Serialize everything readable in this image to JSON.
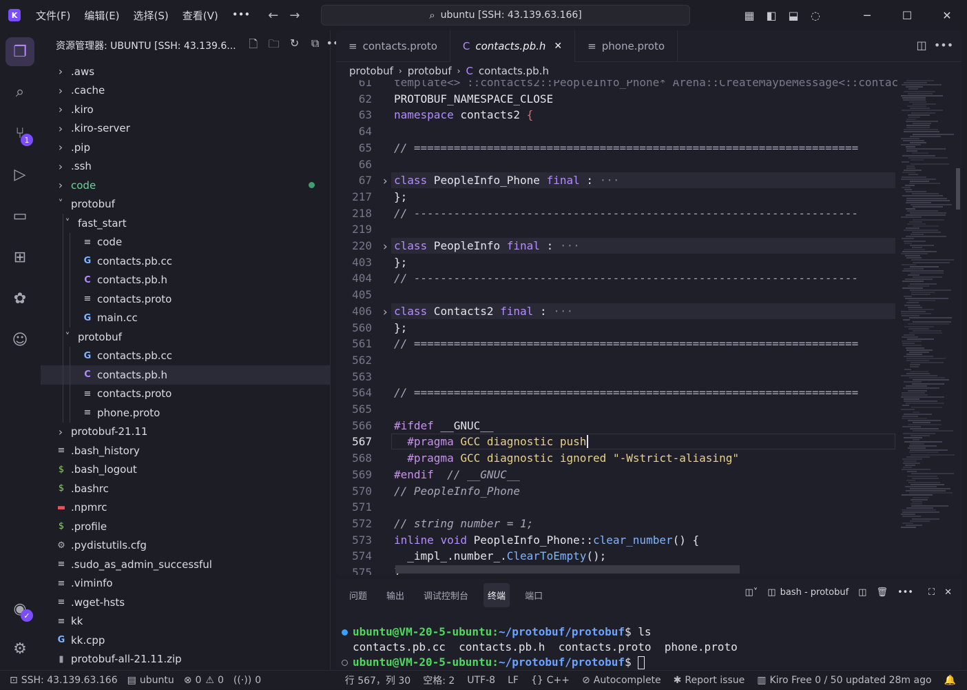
{
  "titlebar": {
    "logo": "K",
    "menus": [
      "文件(F)",
      "编辑(E)",
      "选择(S)",
      "查看(V)",
      "•••"
    ],
    "search": "ubuntu [SSH: 43.139.63.166]"
  },
  "activity": {
    "scm_badge": "1"
  },
  "sidebar": {
    "title": "资源管理器: UBUNTU [SSH: 43.139.6...",
    "tree": [
      {
        "label": ".aws",
        "level": 0,
        "type": "folder",
        "open": false
      },
      {
        "label": ".cache",
        "level": 0,
        "type": "folder",
        "open": false
      },
      {
        "label": ".kiro",
        "level": 0,
        "type": "folder",
        "open": false
      },
      {
        "label": ".kiro-server",
        "level": 0,
        "type": "folder",
        "open": false
      },
      {
        "label": ".pip",
        "level": 0,
        "type": "folder",
        "open": false
      },
      {
        "label": ".ssh",
        "level": 0,
        "type": "folder",
        "open": false
      },
      {
        "label": "code",
        "level": 0,
        "type": "folder",
        "open": false,
        "modified": true
      },
      {
        "label": "protobuf",
        "level": 0,
        "type": "folder",
        "open": true
      },
      {
        "label": "fast_start",
        "level": 1,
        "type": "folder",
        "open": true
      },
      {
        "label": "code",
        "level": 2,
        "type": "text"
      },
      {
        "label": "contacts.pb.cc",
        "level": 2,
        "type": "cpp"
      },
      {
        "label": "contacts.pb.h",
        "level": 2,
        "type": "c"
      },
      {
        "label": "contacts.proto",
        "level": 2,
        "type": "text"
      },
      {
        "label": "main.cc",
        "level": 2,
        "type": "cpp"
      },
      {
        "label": "protobuf",
        "level": 1,
        "type": "folder",
        "open": true
      },
      {
        "label": "contacts.pb.cc",
        "level": 2,
        "type": "cpp"
      },
      {
        "label": "contacts.pb.h",
        "level": 2,
        "type": "c",
        "selected": true
      },
      {
        "label": "contacts.proto",
        "level": 2,
        "type": "text"
      },
      {
        "label": "phone.proto",
        "level": 2,
        "type": "text"
      },
      {
        "label": "protobuf-21.11",
        "level": 0,
        "type": "folder",
        "open": false
      },
      {
        "label": ".bash_history",
        "level": 0,
        "type": "text"
      },
      {
        "label": ".bash_logout",
        "level": 0,
        "type": "shell"
      },
      {
        "label": ".bashrc",
        "level": 0,
        "type": "shell"
      },
      {
        "label": ".npmrc",
        "level": 0,
        "type": "npm"
      },
      {
        "label": ".profile",
        "level": 0,
        "type": "shell"
      },
      {
        "label": ".pydistutils.cfg",
        "level": 0,
        "type": "gear"
      },
      {
        "label": ".sudo_as_admin_successful",
        "level": 0,
        "type": "text"
      },
      {
        "label": ".viminfo",
        "level": 0,
        "type": "text"
      },
      {
        "label": ".wget-hsts",
        "level": 0,
        "type": "text"
      },
      {
        "label": "kk",
        "level": 0,
        "type": "text"
      },
      {
        "label": "kk.cpp",
        "level": 0,
        "type": "cpp"
      },
      {
        "label": "protobuf-all-21.11.zip",
        "level": 0,
        "type": "zip"
      }
    ]
  },
  "editor": {
    "tabs": [
      {
        "label": "contacts.proto",
        "icon": "≡",
        "active": false
      },
      {
        "label": "contacts.pb.h",
        "icon": "C",
        "active": true
      },
      {
        "label": "phone.proto",
        "icon": "≡",
        "active": false
      }
    ],
    "breadcrumb": [
      "protobuf",
      "protobuf",
      "contacts.pb.h"
    ],
    "current_line": "567",
    "lines": [
      {
        "n": "61",
        "html": "<span class=\"dim\">template&lt;&gt; ::contacts2::PeopleInfo_Phone* Arena::CreateMaybeMessage&lt;::contac</span>"
      },
      {
        "n": "62",
        "html": "PROTOBUF_NAMESPACE_CLOSE"
      },
      {
        "n": "63",
        "html": "<span class=\"kw\">namespace</span> contacts2 <span class=\"br\">{</span>"
      },
      {
        "n": "64",
        "html": ""
      },
      {
        "n": "65",
        "html": "<span class=\"cm\">// ===================================================================</span>"
      },
      {
        "n": "66",
        "html": ""
      },
      {
        "n": "67",
        "html": "<span class=\"kw\">class</span> PeopleInfo_Phone <span class=\"kw\">final</span> : <span class=\"dim\">···</span>",
        "fold": true,
        "hl": true
      },
      {
        "n": "217",
        "html": "};"
      },
      {
        "n": "218",
        "html": "<span class=\"cm\">// -------------------------------------------------------------------</span>"
      },
      {
        "n": "219",
        "html": ""
      },
      {
        "n": "220",
        "html": "<span class=\"kw\">class</span> PeopleInfo <span class=\"kw\">final</span> : <span class=\"dim\">···</span>",
        "fold": true,
        "hl": true
      },
      {
        "n": "403",
        "html": "};"
      },
      {
        "n": "404",
        "html": "<span class=\"cm\">// -------------------------------------------------------------------</span>"
      },
      {
        "n": "405",
        "html": ""
      },
      {
        "n": "406",
        "html": "<span class=\"kw\">class</span> Contacts2 <span class=\"kw\">final</span> : <span class=\"dim\">···</span>",
        "fold": true,
        "hl": true
      },
      {
        "n": "560",
        "html": "};"
      },
      {
        "n": "561",
        "html": "<span class=\"cm\">// ===================================================================</span>"
      },
      {
        "n": "562",
        "html": ""
      },
      {
        "n": "563",
        "html": ""
      },
      {
        "n": "564",
        "html": "<span class=\"cm\">// ===================================================================</span>"
      },
      {
        "n": "565",
        "html": ""
      },
      {
        "n": "566",
        "html": "<span class=\"pp\">#ifdef</span> __GNUC__"
      },
      {
        "n": "567",
        "html": "  <span class=\"pp\">#pragma</span> <span class=\"st\">GCC</span> <span class=\"st\">diagnostic</span> <span class=\"st\">push</span>",
        "cur": true
      },
      {
        "n": "568",
        "html": "  <span class=\"pp\">#pragma</span> <span class=\"st\">GCC</span> <span class=\"st\">diagnostic</span> <span class=\"st\">ignored</span> <span class=\"st\">\"-Wstrict-aliasing\"</span>"
      },
      {
        "n": "569",
        "html": "<span class=\"pp\">#endif</span>  <span class=\"cm\">// __GNUC__</span>"
      },
      {
        "n": "570",
        "html": "<span class=\"cm\">// PeopleInfo_Phone</span>"
      },
      {
        "n": "571",
        "html": ""
      },
      {
        "n": "572",
        "html": "<span class=\"cm\">// string number = 1;</span>"
      },
      {
        "n": "573",
        "html": "<span class=\"kw\">inline</span> <span class=\"kw\">void</span> PeopleInfo_Phone::<span class=\"fn\">clear_number</span>() {"
      },
      {
        "n": "574",
        "html": "  _impl_.number_.<span class=\"fn\">ClearToEmpty</span>();"
      },
      {
        "n": "575",
        "html": "}"
      }
    ]
  },
  "panel": {
    "tabs": [
      "问题",
      "输出",
      "调试控制台",
      "终端",
      "端口"
    ],
    "active_tab": "终端",
    "terminal_name": "bash - protobuf",
    "terminal": [
      {
        "prompt": "ubuntu@VM-20-5-ubuntu",
        "path": "~/protobuf/protobuf",
        "cmd": "ls",
        "dot": "#3aa0ff"
      },
      {
        "output": "contacts.pb.cc  contacts.pb.h  contacts.proto  phone.proto"
      },
      {
        "prompt": "ubuntu@VM-20-5-ubuntu",
        "path": "~/protobuf/protobuf",
        "cmd": "",
        "cursor": true,
        "dot": "hollow"
      }
    ]
  },
  "status": {
    "ssh": "SSH: 43.139.63.166",
    "host": "ubuntu",
    "errors": "0",
    "warnings": "0",
    "ports": "0",
    "position": "行 567，列 30",
    "spaces": "空格: 2",
    "encoding": "UTF-8",
    "eol": "LF",
    "language": "C++",
    "autocomplete": "Autocomplete",
    "report": "Report issue",
    "kiro": "Kiro Free 0 / 50 updated 28m ago"
  },
  "colors": {
    "accent": "#7c4dff",
    "prompt": "#4fd85e",
    "path": "#6ba3ff"
  }
}
